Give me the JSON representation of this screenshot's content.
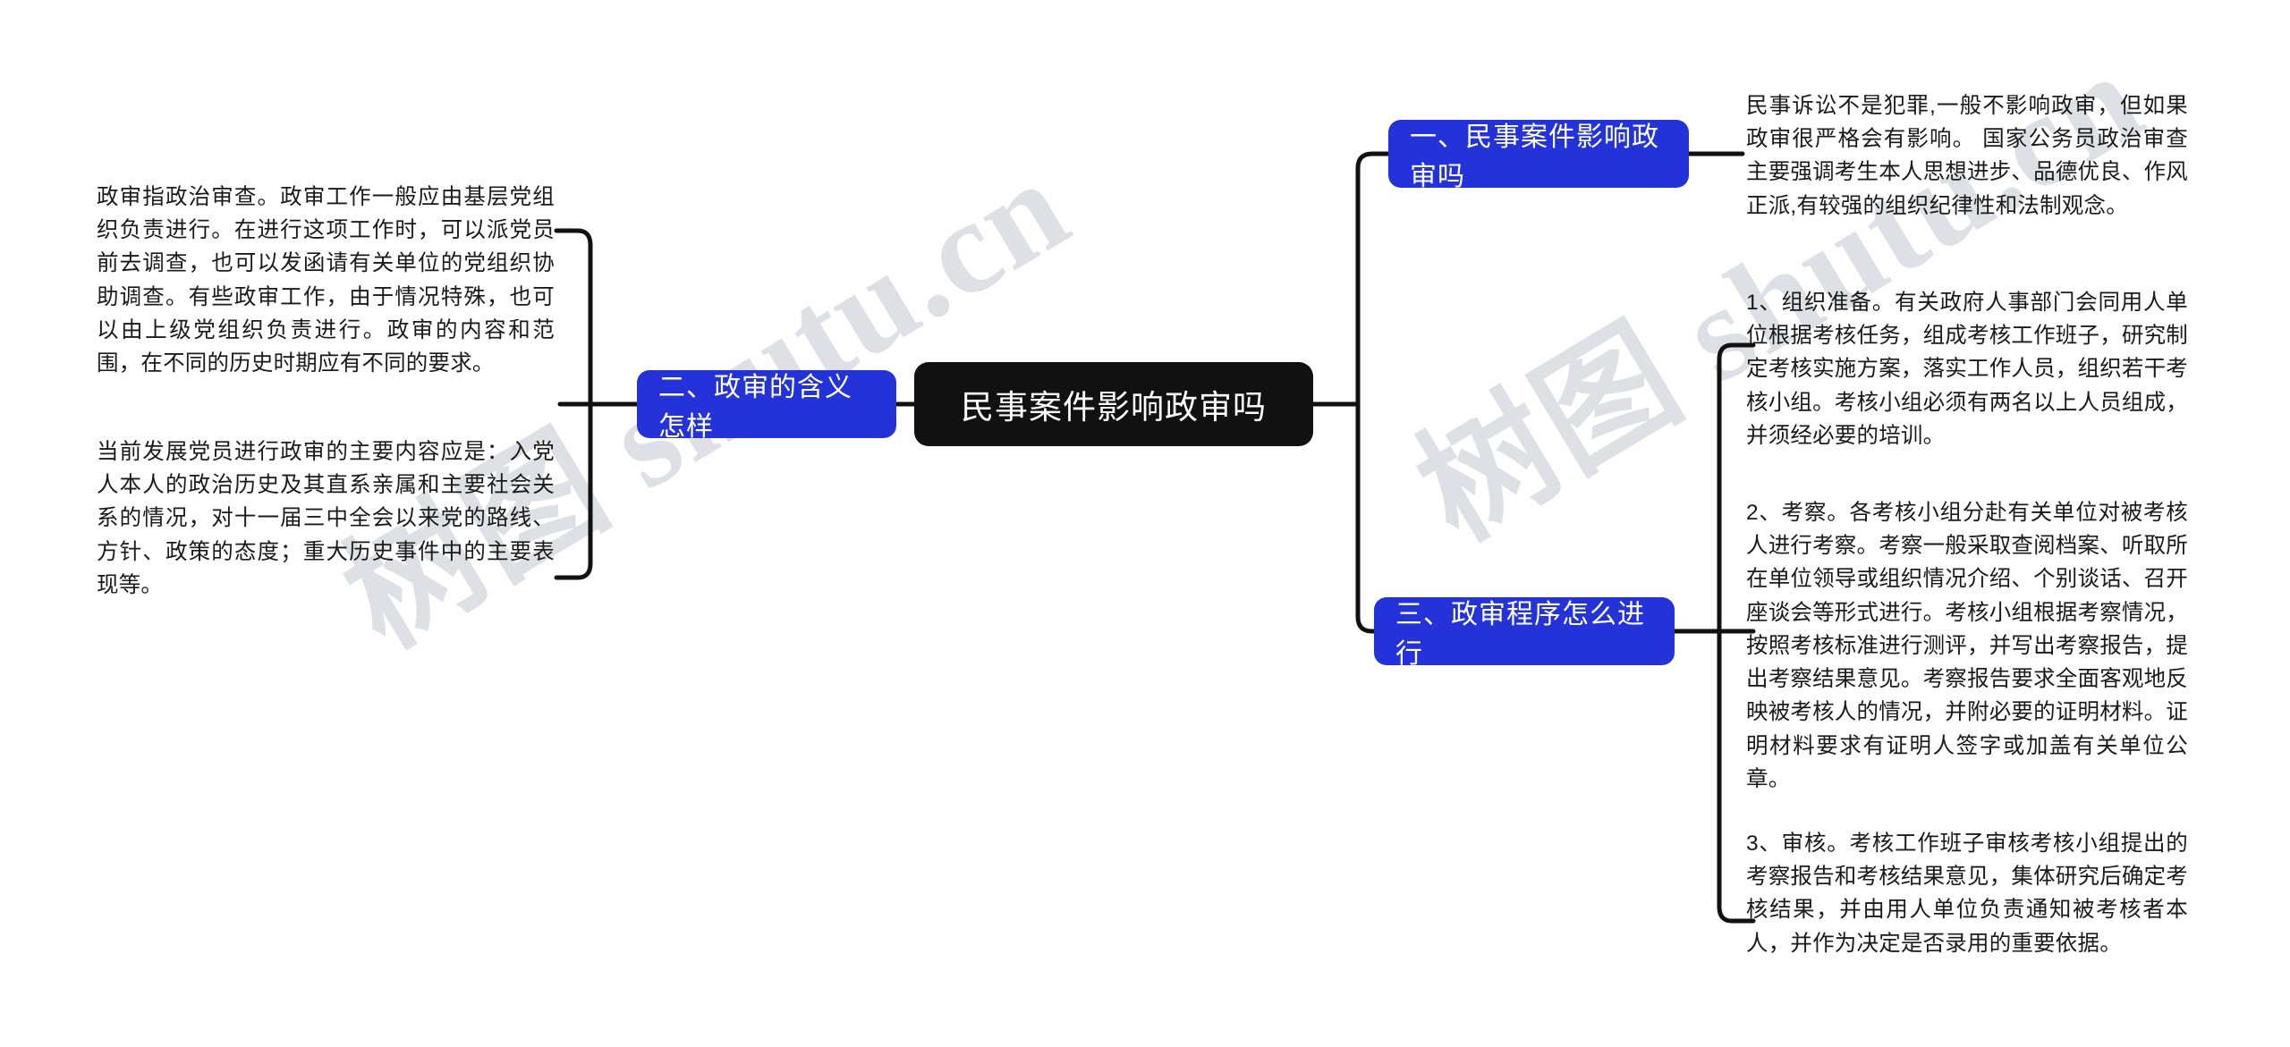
{
  "diagram": {
    "type": "mind-map",
    "watermark": "树图 shutu.cn",
    "colors": {
      "root_bg": "#111111",
      "branch_bg": "#2333d9",
      "text": "#1a1a1a",
      "connector": "#111111",
      "watermark": "#dfe0e6"
    },
    "root": {
      "label": "民事案件影响政审吗"
    },
    "branches": [
      {
        "id": "branch-1",
        "label": "一、民事案件影响政审吗",
        "side": "right",
        "leaves": [
          {
            "id": "leaf-1-1",
            "text": "民事诉讼不是犯罪,一般不影响政审，但如果政审很严格会有影响。 国家公务员政治审查主要强调考生本人思想进步、品德优良、作风正派,有较强的组织纪律性和法制观念。"
          }
        ]
      },
      {
        "id": "branch-2",
        "label": "二、政审的含义怎样",
        "side": "left",
        "leaves": [
          {
            "id": "leaf-2-1",
            "text": "政审指政治审查。政审工作一般应由基层党组织负责进行。在进行这项工作时，可以派党员前去调查，也可以发函请有关单位的党组织协助调查。有些政审工作，由于情况特殊，也可以由上级党组织负责进行。政审的内容和范围，在不同的历史时期应有不同的要求。"
          },
          {
            "id": "leaf-2-2",
            "text": "当前发展党员进行政审的主要内容应是：入党人本人的政治历史及其直系亲属和主要社会关系的情况，对十一届三中全会以来党的路线、方针、政策的态度；重大历史事件中的主要表现等。"
          }
        ]
      },
      {
        "id": "branch-3",
        "label": "三、政审程序怎么进行",
        "side": "right",
        "leaves": [
          {
            "id": "leaf-3-1",
            "text": "1、组织准备。有关政府人事部门会同用人单位根据考核任务，组成考核工作班子，研究制定考核实施方案，落实工作人员，组织若干考核小组。考核小组必须有两名以上人员组成，并须经必要的培训。"
          },
          {
            "id": "leaf-3-2",
            "text": "2、考察。各考核小组分赴有关单位对被考核人进行考察。考察一般采取查阅档案、听取所在单位领导或组织情况介绍、个别谈话、召开座谈会等形式进行。考核小组根据考察情况，按照考核标准进行测评，并写出考察报告，提出考察结果意见。考察报告要求全面客观地反映被考核人的情况，并附必要的证明材料。证明材料要求有证明人签字或加盖有关单位公章。"
          },
          {
            "id": "leaf-3-3",
            "text": "3、审核。考核工作班子审核考核小组提出的考察报告和考核结果意见，集体研究后确定考核结果，并由用人单位负责通知被考核者本人，并作为决定是否录用的重要依据。"
          }
        ]
      }
    ]
  }
}
